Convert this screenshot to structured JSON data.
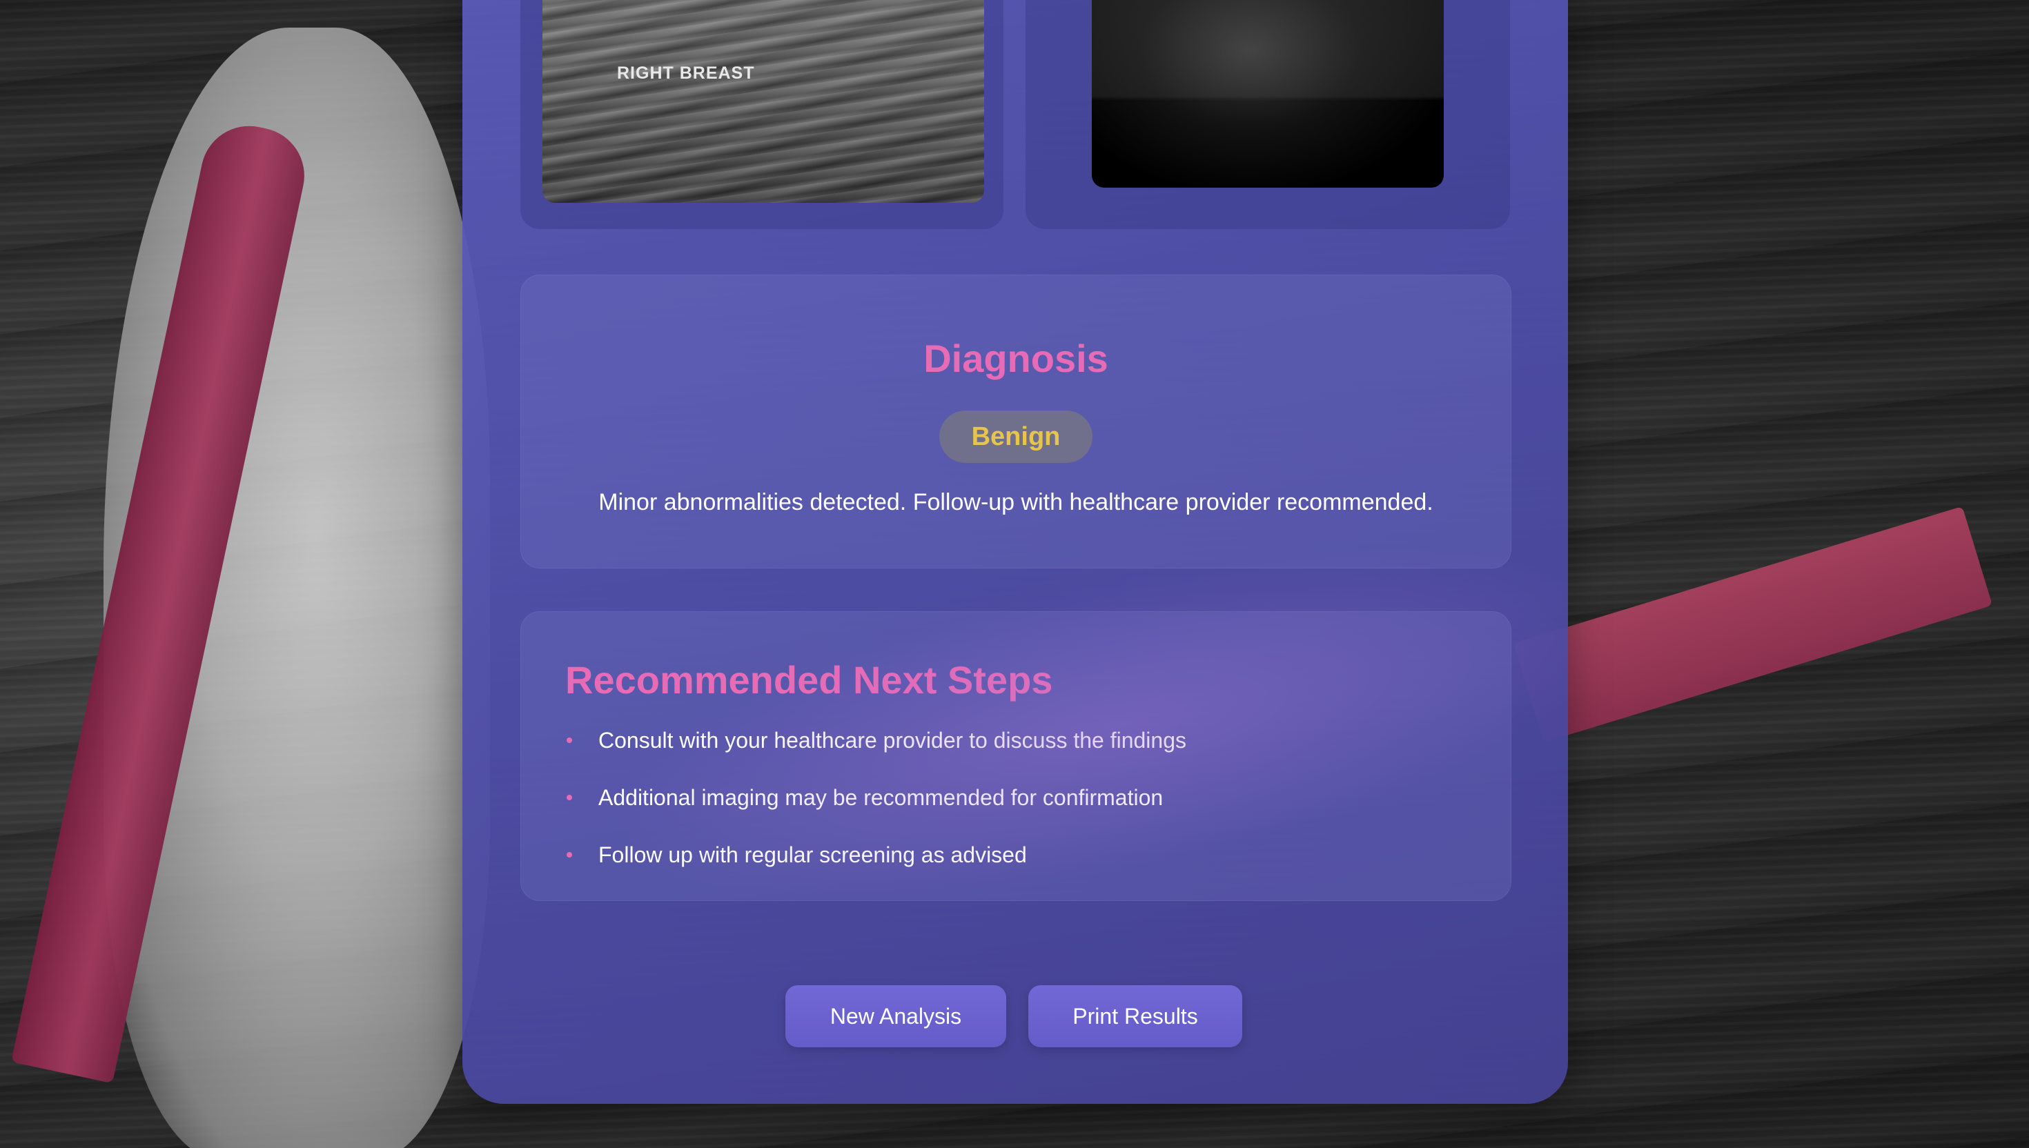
{
  "images": {
    "ultrasound_label": "RIGHT BREAST"
  },
  "diagnosis": {
    "title": "Diagnosis",
    "badge": "Benign",
    "description": "Minor abnormalities detected. Follow-up with healthcare provider recommended."
  },
  "next_steps": {
    "title": "Recommended Next Steps",
    "items": [
      "Consult with your healthcare provider to discuss the findings",
      "Additional imaging may be recommended for confirmation",
      "Follow up with regular screening as advised"
    ]
  },
  "actions": {
    "new_analysis": "New Analysis",
    "print_results": "Print Results"
  },
  "colors": {
    "accent_pink": "#e86bb5",
    "badge_text": "#e6c44e",
    "button": "#6a62cf"
  }
}
